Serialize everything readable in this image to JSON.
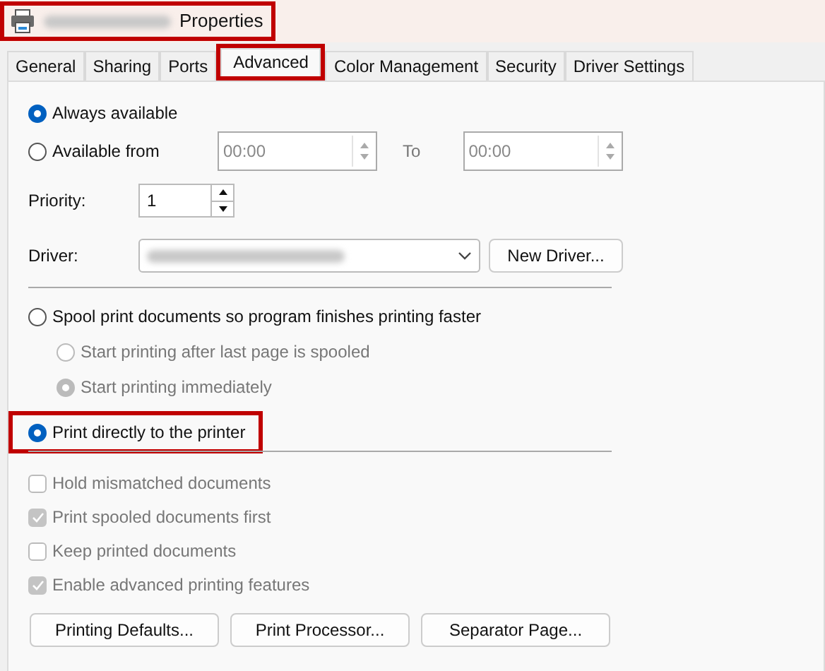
{
  "window": {
    "title": "Properties",
    "highlighted": true
  },
  "tabs": [
    {
      "label": "General",
      "selected": false,
      "highlighted": false
    },
    {
      "label": "Sharing",
      "selected": false,
      "highlighted": false
    },
    {
      "label": "Ports",
      "selected": false,
      "highlighted": false
    },
    {
      "label": "Advanced",
      "selected": true,
      "highlighted": true
    },
    {
      "label": "Color Management",
      "selected": false,
      "highlighted": false
    },
    {
      "label": "Security",
      "selected": false,
      "highlighted": false
    },
    {
      "label": "Driver Settings",
      "selected": false,
      "highlighted": false
    }
  ],
  "availability": [
    {
      "label": "Always available",
      "selected": true
    },
    {
      "label": "Available from",
      "selected": false
    }
  ],
  "from_time": {
    "value": "00:00"
  },
  "to_label": "To",
  "to_time": {
    "value": "00:00"
  },
  "priority": {
    "label": "Priority:",
    "value": "1"
  },
  "driver": {
    "label": "Driver:",
    "button": "New Driver..."
  },
  "spooling": [
    {
      "label": "Spool print documents so program finishes printing faster",
      "selected": false,
      "disabled": false,
      "highlighted": false,
      "children": [
        {
          "label": "Start printing after last page is spooled",
          "selected": false,
          "disabled": true
        },
        {
          "label": "Start printing immediately",
          "selected": true,
          "disabled": true
        }
      ]
    },
    {
      "label": "Print directly to the printer",
      "selected": true,
      "disabled": false,
      "highlighted": true
    }
  ],
  "options": [
    {
      "label": "Hold mismatched documents",
      "checked": false,
      "disabled": true
    },
    {
      "label": "Print spooled documents first",
      "checked": true,
      "disabled": true
    },
    {
      "label": "Keep printed documents",
      "checked": false,
      "disabled": true
    },
    {
      "label": "Enable advanced printing features",
      "checked": true,
      "disabled": true
    }
  ],
  "buttons": [
    "Printing Defaults...",
    "Print Processor...",
    "Separator Page..."
  ]
}
